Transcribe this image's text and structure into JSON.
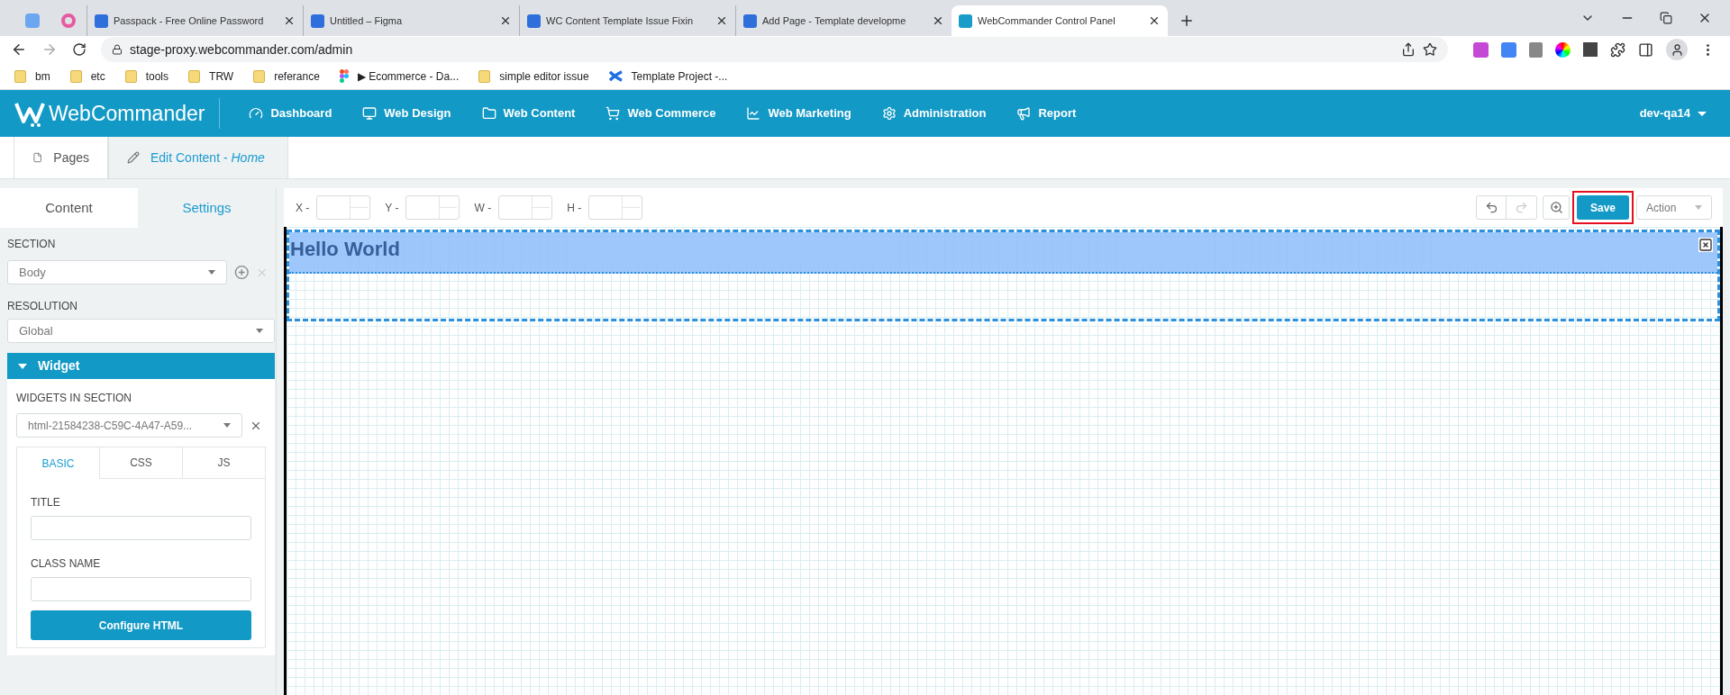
{
  "browser": {
    "tabs": [
      {
        "title": "Passpack - Free Online Password",
        "selected": false
      },
      {
        "title": "Untitled – Figma",
        "selected": false
      },
      {
        "title": "WC Content Template Issue Fixin",
        "selected": false
      },
      {
        "title": "Add Page - Template developme",
        "selected": false
      },
      {
        "title": "WebCommander Control Panel",
        "selected": true
      }
    ],
    "address": "stage-proxy.webcommander.com/admin",
    "bookmarks": [
      {
        "kind": "folder",
        "label": "bm"
      },
      {
        "kind": "folder",
        "label": "etc"
      },
      {
        "kind": "folder",
        "label": "tools"
      },
      {
        "kind": "folder",
        "label": "TRW"
      },
      {
        "kind": "folder",
        "label": "referance"
      },
      {
        "kind": "figma",
        "label": "▶ Ecommerce - Da..."
      },
      {
        "kind": "folder",
        "label": "simple editor issue"
      },
      {
        "kind": "confluence",
        "label": "Template Project -..."
      }
    ]
  },
  "app": {
    "logo": "WebCommander",
    "nav": [
      {
        "label": "Dashboard"
      },
      {
        "label": "Web Design"
      },
      {
        "label": "Web Content"
      },
      {
        "label": "Web Commerce"
      },
      {
        "label": "Web Marketing"
      },
      {
        "label": "Administration"
      },
      {
        "label": "Report"
      }
    ],
    "user": "dev-qa14"
  },
  "page_tabs": [
    {
      "label": "Pages",
      "selected": false
    },
    {
      "label": "Edit Content - *Home*",
      "selected": true
    }
  ],
  "sidebar": {
    "tabs": [
      {
        "label": "Content",
        "selected": true
      },
      {
        "label": "Settings",
        "selected": false
      }
    ],
    "section_label": "SECTION",
    "section_value": "Body",
    "resolution_label": "RESOLUTION",
    "resolution_value": "Global",
    "widget": {
      "title": "Widget",
      "expanded": true,
      "widgets_label": "WIDGETS IN SECTION",
      "widget_value": "html-21584238-C59C-4A47-A59...",
      "tabs": [
        {
          "label": "BASIC",
          "selected": true
        },
        {
          "label": "CSS",
          "selected": false
        },
        {
          "label": "JS",
          "selected": false
        }
      ],
      "title_label": "TITLE",
      "class_label": "CLASS NAME",
      "configure_button": "Configure HTML"
    }
  },
  "toolbar": {
    "fields": [
      {
        "label": "X -"
      },
      {
        "label": "Y -"
      },
      {
        "label": "W -"
      },
      {
        "label": "H -"
      }
    ],
    "redo_disabled": true,
    "save": "Save",
    "save_highlighted": true,
    "action": "Action"
  },
  "canvas": {
    "heading": "Hello World",
    "widget_selected": true
  }
}
